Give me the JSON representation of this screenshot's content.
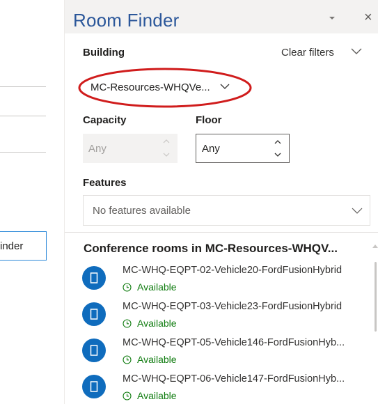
{
  "left": {
    "button_label": "inder"
  },
  "panel": {
    "title": "Room Finder",
    "header_icons": [
      "chevron-down-icon",
      "close-icon"
    ],
    "close_glyph": "×"
  },
  "filters": {
    "building_label": "Building",
    "clear_filters": "Clear filters",
    "building_value": "MC-Resources-WHQVe...",
    "capacity_label": "Capacity",
    "capacity_value": "Any",
    "floor_label": "Floor",
    "floor_value": "Any",
    "features_label": "Features",
    "features_value": "No features available"
  },
  "rooms": {
    "heading": "Conference rooms in MC-Resources-WHQV...",
    "items": [
      {
        "name": "MC-WHQ-EQPT-02-Vehicle20-FordFusionHybrid",
        "status": "Available"
      },
      {
        "name": "MC-WHQ-EQPT-03-Vehicle23-FordFusionHybrid",
        "status": "Available"
      },
      {
        "name": "MC-WHQ-EQPT-05-Vehicle146-FordFusionHyb...",
        "status": "Available"
      },
      {
        "name": "MC-WHQ-EQPT-06-Vehicle147-FordFusionHyb...",
        "status": "Available"
      }
    ]
  },
  "colors": {
    "title": "#2b579a",
    "avatar": "#0f6cbd",
    "available": "#107c10",
    "highlight": "#d01c1c"
  }
}
